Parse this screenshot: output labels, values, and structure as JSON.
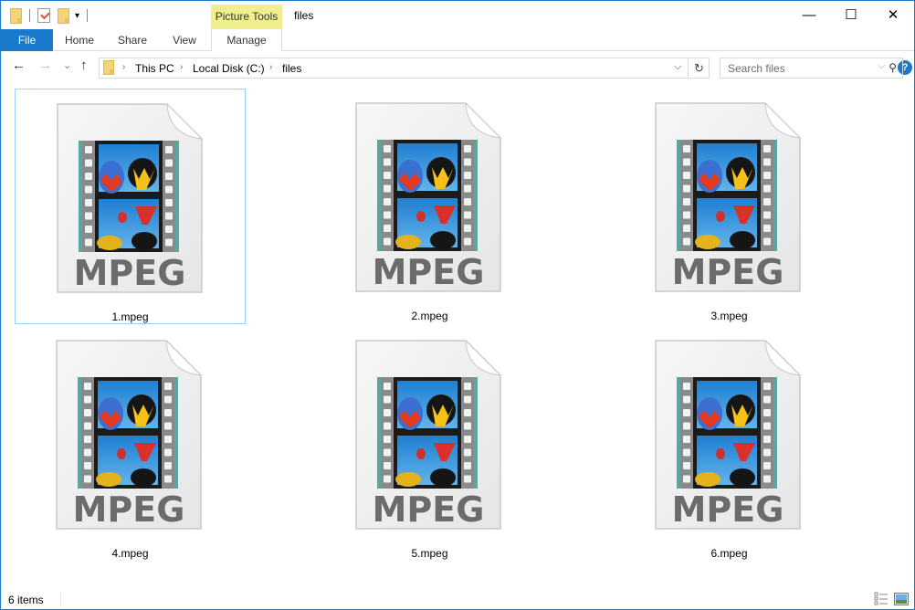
{
  "window": {
    "title": "files",
    "context_tab_group": "Picture Tools",
    "controls": {
      "minimize": "—",
      "maximize": "☐",
      "close": "✕"
    }
  },
  "quick_access": {
    "icons": [
      "folder-icon",
      "properties-check-icon",
      "new-folder-icon",
      "customize-dropdown-icon"
    ],
    "dropdown_glyph": "▾"
  },
  "ribbon": {
    "tabs": [
      {
        "label": "File",
        "active": true
      },
      {
        "label": "Home"
      },
      {
        "label": "Share"
      },
      {
        "label": "View"
      },
      {
        "label": "Manage"
      }
    ],
    "expand_glyph": "⌵",
    "help_glyph": "?"
  },
  "navigation": {
    "back": "←",
    "forward": "→",
    "recent": "⌄",
    "up": "↑",
    "breadcrumb": [
      "This PC",
      "Local Disk (C:)",
      "files"
    ],
    "separator": "›",
    "address_dropdown": "⌵",
    "refresh": "↻",
    "search_placeholder": "Search files",
    "search_glyph": "⚲"
  },
  "files": [
    {
      "name": "1.mpeg",
      "type_label": "MPEG",
      "selected": true
    },
    {
      "name": "2.mpeg",
      "type_label": "MPEG",
      "selected": false
    },
    {
      "name": "3.mpeg",
      "type_label": "MPEG",
      "selected": false
    },
    {
      "name": "4.mpeg",
      "type_label": "MPEG",
      "selected": false
    },
    {
      "name": "5.mpeg",
      "type_label": "MPEG",
      "selected": false
    },
    {
      "name": "6.mpeg",
      "type_label": "MPEG",
      "selected": false
    }
  ],
  "status": {
    "item_count": "6 items"
  },
  "colors": {
    "accent": "#1979ca",
    "picture_tools": "#f0ef8e",
    "selection_border": "#99d1ff",
    "mpeg_text": "#6b6b6b"
  }
}
